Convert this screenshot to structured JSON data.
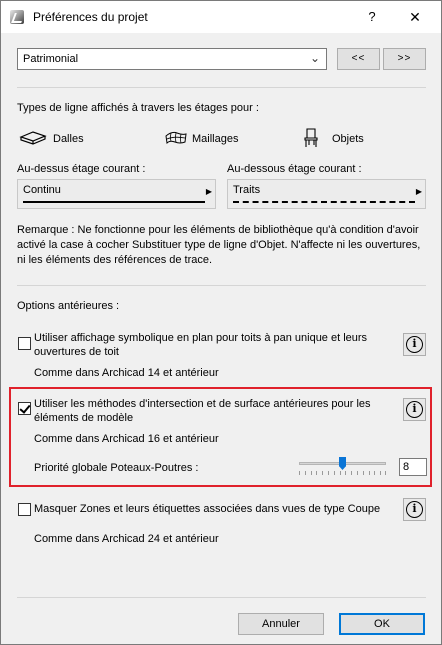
{
  "window": {
    "title": "Préférences du projet",
    "help_label": "?",
    "close_label": "✕"
  },
  "preset": {
    "selected": "Patrimonial",
    "prev_label": "<<",
    "next_label": ">>"
  },
  "line_types": {
    "heading": "Types de ligne affichés à travers les étages pour :",
    "elements": [
      {
        "label": "Dalles",
        "icon": "slab-icon"
      },
      {
        "label": "Maillages",
        "icon": "mesh-icon"
      },
      {
        "label": "Objets",
        "icon": "chair-object-icon"
      }
    ],
    "above_label": "Au-dessus étage courant :",
    "above_value": "Continu",
    "below_label": "Au-dessous étage courant :",
    "below_value": "Traits",
    "remark": "Remarque : Ne fonctionne pour les éléments de bibliothèque qu'à condition d'avoir activé la case à cocher Substituer type de ligne d'Objet. N'affecte ni les ouvertures, ni les éléments des références de trace."
  },
  "legacy": {
    "heading": "Options antérieures :",
    "options": [
      {
        "label": "Utiliser affichage symbolique en plan pour toits à pan unique et leurs ouvertures de toit",
        "checked": false,
        "note": "Comme dans Archicad 14 et antérieur"
      },
      {
        "label": "Utiliser les méthodes d'intersection et de surface antérieures pour les éléments de modèle",
        "checked": true,
        "note": "Comme dans Archicad 16 et antérieur"
      },
      {
        "label": "Masquer Zones et leurs étiquettes associées dans vues de type Coupe",
        "checked": false,
        "note": "Comme dans Archicad 24 et antérieur"
      }
    ],
    "priority_label": "Priorité globale Poteaux-Poutres :",
    "priority_value": "8",
    "priority_min": 1,
    "priority_max": 16
  },
  "footer": {
    "cancel_label": "Annuler",
    "ok_label": "OK"
  },
  "colors": {
    "highlight_border": "#e0212b",
    "slider_thumb": "#0a75d6",
    "dialog_bg": "#f0f0f0"
  }
}
